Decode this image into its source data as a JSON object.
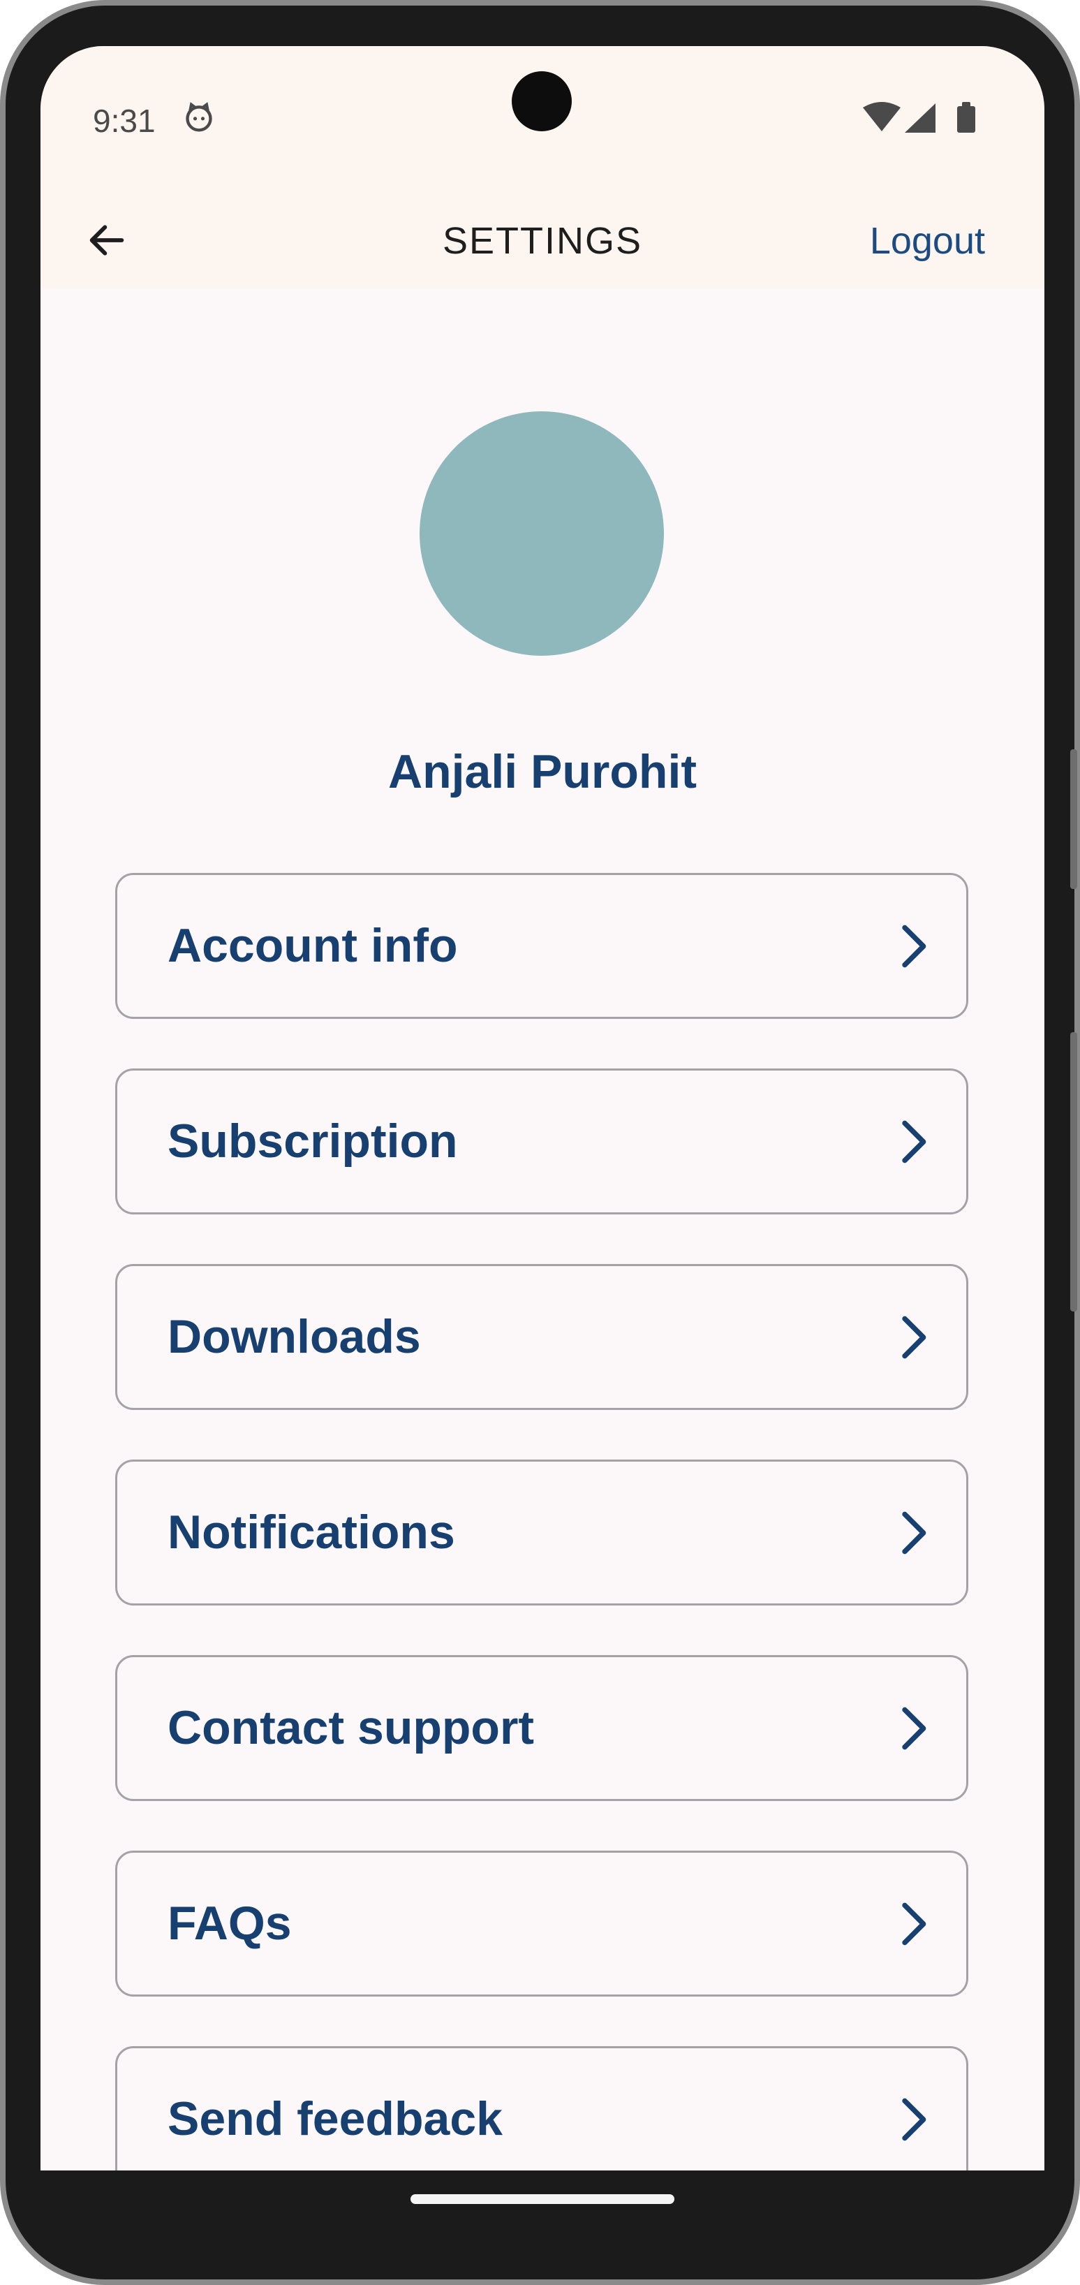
{
  "status_bar": {
    "time": "9:31",
    "icons": [
      "cat-face-icon",
      "wifi-icon",
      "signal-icon",
      "battery-icon"
    ]
  },
  "header": {
    "title": "SETTINGS",
    "logout_label": "Logout",
    "back_icon": "arrow-left-icon"
  },
  "profile": {
    "name": "Anjali Purohit",
    "avatar_color": "#8fb8bc"
  },
  "menu": {
    "items": [
      {
        "label": "Account info"
      },
      {
        "label": "Subscription"
      },
      {
        "label": "Downloads"
      },
      {
        "label": "Notifications"
      },
      {
        "label": "Contact support"
      },
      {
        "label": "FAQs"
      },
      {
        "label": "Send feedback"
      }
    ]
  },
  "colors": {
    "header_bg": "#fdf6f0",
    "accent": "#173f70",
    "screen_bg": "#fcf8fa",
    "card_border": "#a3a3a7"
  }
}
